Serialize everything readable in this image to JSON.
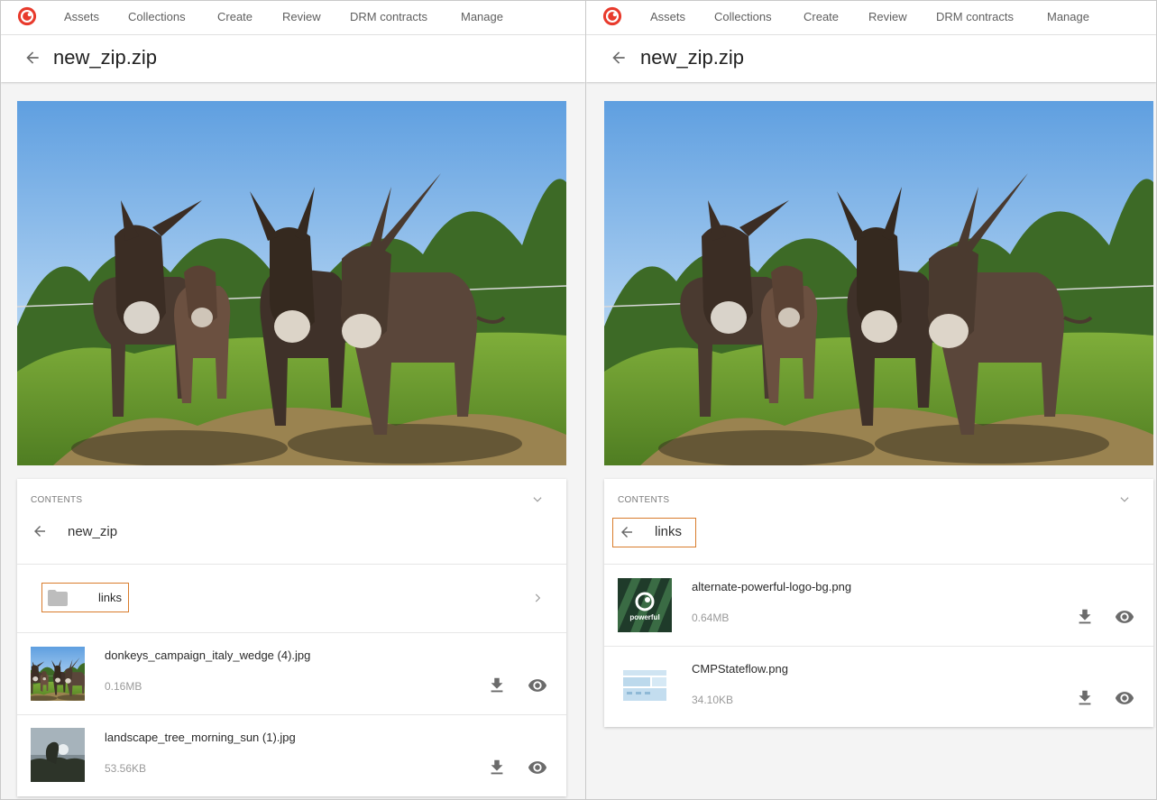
{
  "nav": {
    "items": [
      "Assets",
      "Collections",
      "Create",
      "Review",
      "DRM contracts",
      "Manage"
    ]
  },
  "colors": {
    "brand": "#e83a2c",
    "highlight": "#d97c2c",
    "icon": "#6b6b6b"
  },
  "left": {
    "title": "new_zip.zip",
    "contents": {
      "label": "CONTENTS",
      "crumb": "new_zip",
      "folder": {
        "name": "links"
      },
      "files": [
        {
          "name": "donkeys_campaign_italy_wedge (4).jpg",
          "size": "0.16MB"
        },
        {
          "name": "landscape_tree_morning_sun (1).jpg",
          "size": "53.56KB"
        }
      ]
    }
  },
  "right": {
    "title": "new_zip.zip",
    "contents": {
      "label": "CONTENTS",
      "crumb": "links",
      "files": [
        {
          "name": "alternate-powerful-logo-bg.png",
          "size": "0.64MB",
          "thumb_text": "powerful"
        },
        {
          "name": "CMPStateflow.png",
          "size": "34.10KB"
        }
      ]
    }
  },
  "icons": {
    "logo": "brand-logo-icon",
    "back": "arrow-left-icon",
    "collapse": "chevron-down-icon",
    "open_folder": "chevron-right-icon",
    "folder": "folder-icon",
    "download": "download-icon",
    "preview": "eye-icon"
  }
}
